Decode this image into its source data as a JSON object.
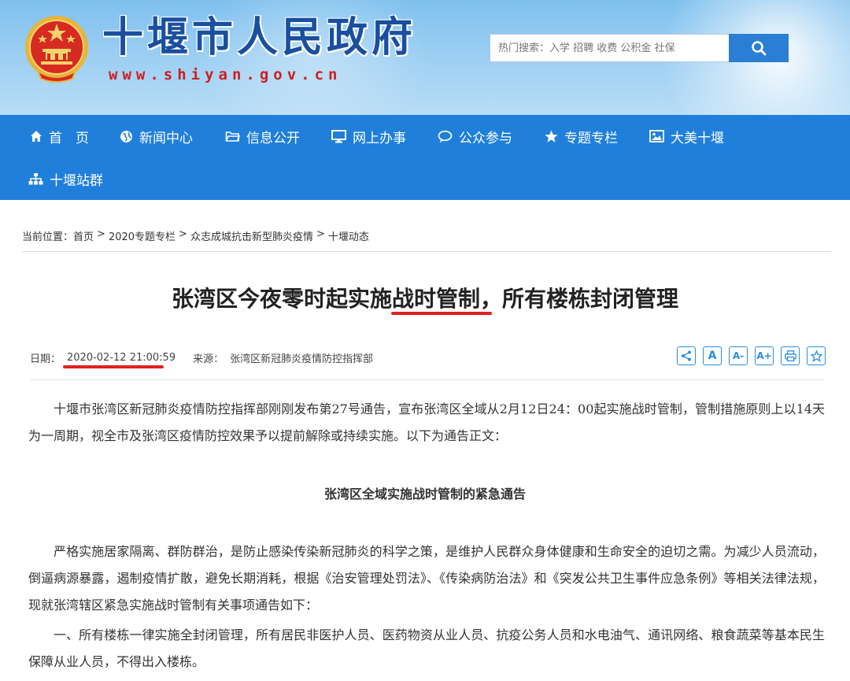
{
  "header": {
    "site_name": "十堰市人民政府",
    "site_url": "www.shiyan.gov.cn",
    "search_placeholder": "热门搜索：入学 招聘 收费 公积金 社保"
  },
  "nav": {
    "items": [
      {
        "label": "首　页",
        "icon": "home-icon"
      },
      {
        "label": "新闻中心",
        "icon": "globe-icon"
      },
      {
        "label": "信息公开",
        "icon": "folder-icon"
      },
      {
        "label": "网上办事",
        "icon": "monitor-icon"
      },
      {
        "label": "公众参与",
        "icon": "chat-icon"
      },
      {
        "label": "专题专栏",
        "icon": "star-icon"
      },
      {
        "label": "大美十堰",
        "icon": "picture-icon"
      },
      {
        "label": "十堰站群",
        "icon": "sitemap-icon"
      }
    ]
  },
  "breadcrumb": {
    "prefix": "当前位置：",
    "items": [
      "首页",
      "2020专题专栏",
      "众志成城抗击新型肺炎疫情",
      "十堰动态"
    ],
    "separator": ">"
  },
  "article": {
    "title_before": "张湾区今夜零时起实施",
    "title_highlight": "战时管制",
    "title_after": "，所有楼栋封闭管理",
    "date_label": "日期：",
    "date": "2020-02-12 21:00:59",
    "source_label": "来源：",
    "source": "张湾区新冠肺炎疫情防控指挥部",
    "paragraphs": [
      "十堰市张湾区新冠肺炎疫情防控指挥部刚刚发布第27号通告，宣布张湾区全域从2月12日24：00起实施战时管制，管制措施原则上以14天为一周期，视全市及张湾区疫情防控效果予以提前解除或持续实施。以下为通告正文：",
      "严格实施居家隔离、群防群治，是防止感染传染新冠肺炎的科学之策，是维护人民群众身体健康和生命安全的迫切之需。为减少人员流动，倒逼病源暴露，遏制疫情扩散，避免长期消耗，根据《治安管理处罚法》、《传染病防治法》和《突发公共卫生事件应急条例》等相关法律法规，现就张湾辖区紧急实施战时管制有关事项通告如下：",
      "一、所有楼栋一律实施全封闭管理，所有居民非医护人员、医药物资从业人员、抗疫公务人员和水电油气、通讯网络、粮食蔬菜等基本民生保障从业人员，不得出入楼栋。"
    ],
    "subheading": "张湾区全域实施战时管制的紧急通告"
  },
  "tools": {
    "font_small": "A",
    "font_decrease": "A-",
    "font_increase": "A+"
  },
  "colors": {
    "nav_bg": "#1f7fdb",
    "brand_blue": "#1a4fa0",
    "url_red": "#cc1f1f",
    "highlight_red": "#e02020"
  }
}
